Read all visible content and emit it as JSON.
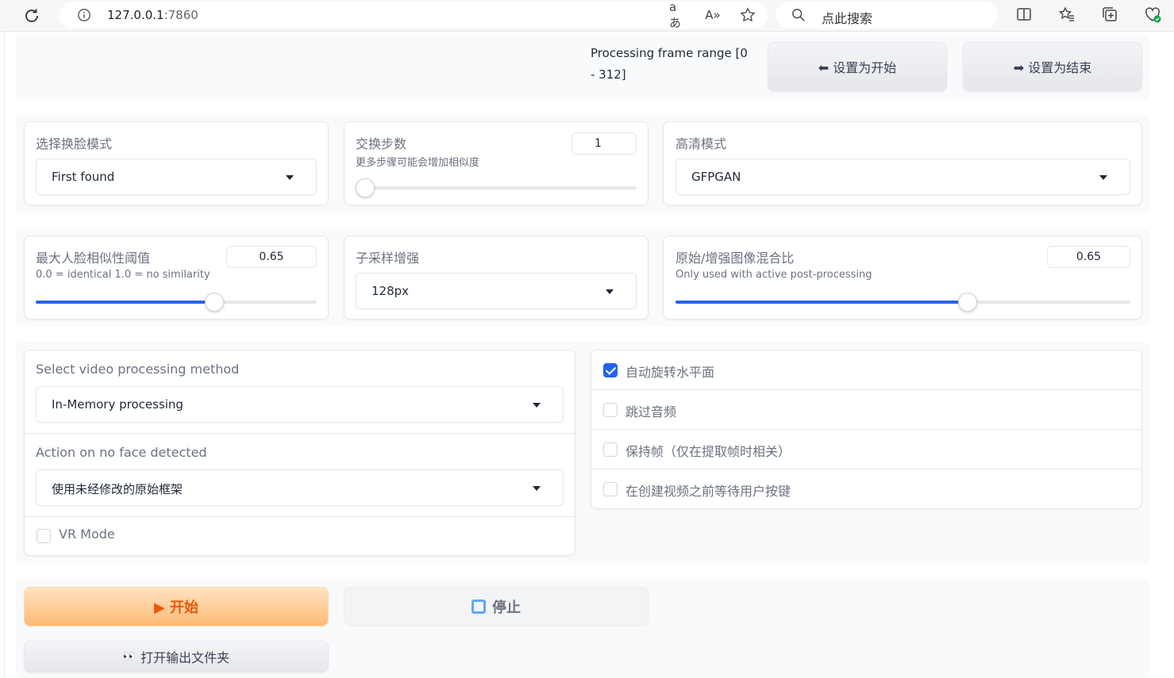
{
  "browser": {
    "url_host": "127.0.0.1",
    "url_port": ":7860",
    "search_placeholder": "点此搜索"
  },
  "frame_range": {
    "label": "Processing frame range [0 - 312]",
    "set_start": "⬅ 设置为开始",
    "set_end": "➡ 设置为结束"
  },
  "swap_mode": {
    "label": "选择换脸模式",
    "value": "First found"
  },
  "swap_steps": {
    "label": "交换步数",
    "info": "更多步骤可能会增加相似度",
    "value": "1",
    "slider_fraction": 0
  },
  "hd_mode": {
    "label": "高清模式",
    "value": "GFPGAN"
  },
  "face_similarity": {
    "label": "最大人脸相似性阈值",
    "info": "0.0 = identical 1.0 = no similarity",
    "value": "0.65",
    "slider_fraction": 0.65
  },
  "subsample": {
    "label": "子采样增强",
    "value": "128px"
  },
  "blend_ratio": {
    "label": "原始/增强图像混合比",
    "info": "Only used with active post-processing",
    "value": "0.65",
    "slider_fraction": 0.65
  },
  "video_method": {
    "label": "Select video processing method",
    "value": "In-Memory processing"
  },
  "no_face_action": {
    "label": "Action on no face detected",
    "value": "使用未经修改的原始框架"
  },
  "vr_mode": {
    "label": "VR Mode",
    "checked": false
  },
  "checkboxes": [
    {
      "label": "自动旋转水平面",
      "checked": true
    },
    {
      "label": "跳过音频",
      "checked": false
    },
    {
      "label": "保持帧（仅在提取帧时相关）",
      "checked": false
    },
    {
      "label": "在创建视频之前等待用户按键",
      "checked": false
    }
  ],
  "actions": {
    "start": "▶ 开始",
    "stop": "停止",
    "open_folder": "打开输出文件夹"
  },
  "colors": {
    "accent": "#2563eb",
    "primary_button": "#fdba74",
    "primary_text": "#ea580c"
  }
}
